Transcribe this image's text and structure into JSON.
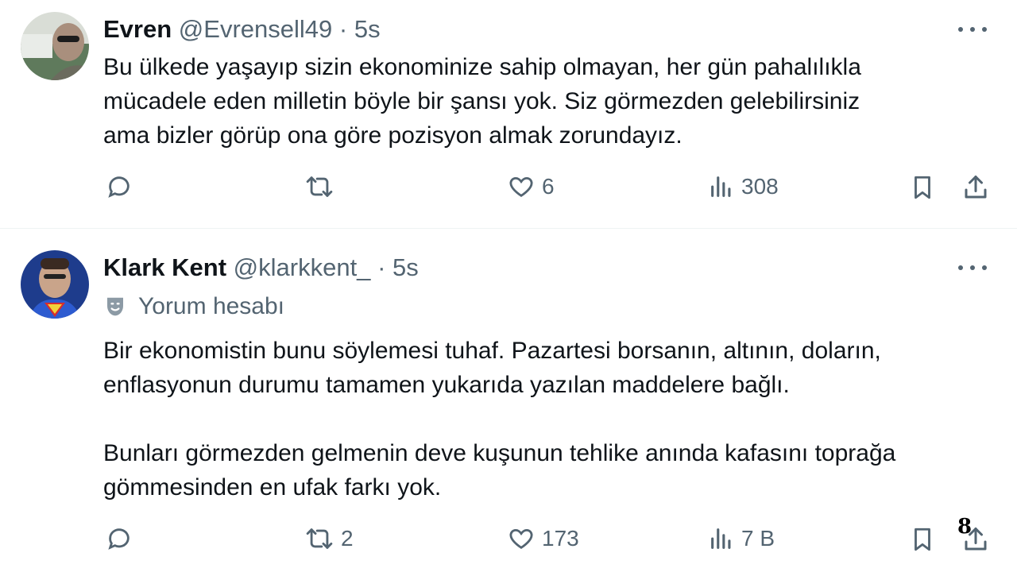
{
  "tweets": [
    {
      "name": "Evren",
      "handle": "@Evrensell49",
      "separator": "·",
      "time": "5s",
      "text": "Bu ülkede yaşayıp sizin ekonominize sahip olmayan, her gün pahalılıkla\nmücadele eden milletin böyle bir şansı yok. Siz görmezden gelebilirsiniz\nama bizler görüp ona göre pozisyon almak zorundayız.",
      "replies": "",
      "retweets": "",
      "likes": "6",
      "views": "308"
    },
    {
      "name": "Klark Kent",
      "handle": "@klarkkent_",
      "separator": "·",
      "time": "5s",
      "label": "Yorum hesabı",
      "text": "Bir ekonomistin bunu söylemesi tuhaf. Pazartesi borsanın, altının, doların,\nenflasyonun durumu tamamen yukarıda yazılan maddelere bağlı.\n\nBunları görmezden gelmenin deve kuşunun tehlike anında kafasını toprağa\ngömmesinden en ufak farkı yok.",
      "replies": "",
      "retweets": "2",
      "likes": "173",
      "views": "7 B"
    }
  ],
  "overlay_number": "8",
  "icons": [
    "reply-icon",
    "retweet-icon",
    "like-icon",
    "views-icon",
    "bookmark-icon",
    "share-icon",
    "more-icon",
    "parody-mask-icon"
  ],
  "colors": {
    "text": "#0f1419",
    "secondary": "#536471",
    "divider": "#eff3f4"
  }
}
